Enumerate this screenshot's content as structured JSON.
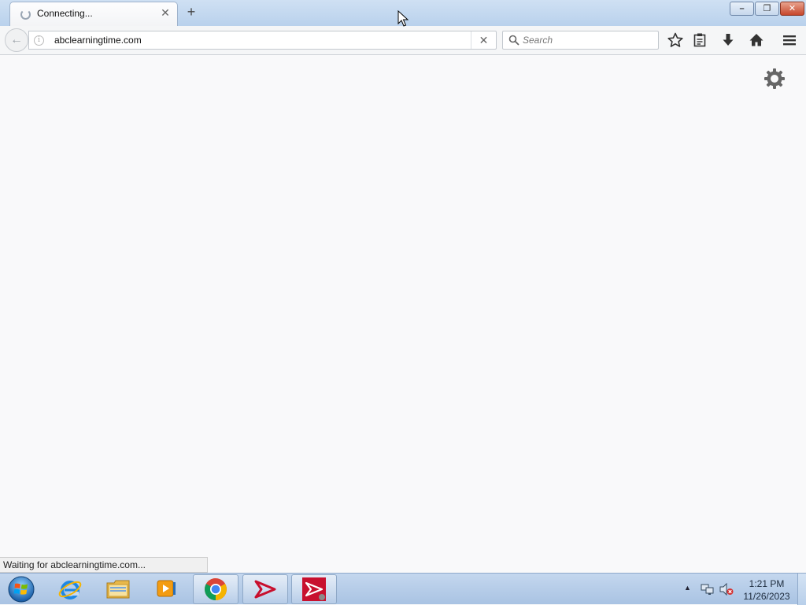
{
  "window": {
    "tab": {
      "title": "Connecting...",
      "close_glyph": "✕"
    },
    "new_tab_glyph": "+",
    "buttons": {
      "minimize_glyph": "–",
      "maximize_glyph": "❐",
      "close_glyph": "✕"
    }
  },
  "navbar": {
    "back_glyph": "←",
    "info_glyph": "i",
    "url": "abclearningtime.com",
    "stop_glyph": "✕",
    "search": {
      "placeholder": "Search"
    }
  },
  "icons": {
    "bookmark_star": "star-icon",
    "reading_list": "clipboard-icon",
    "downloads": "download-icon",
    "home": "home-icon",
    "menu": "hamburger-menu-icon",
    "page_settings": "gear-icon"
  },
  "status": {
    "text": "Waiting for abclearningtime.com..."
  },
  "taskbar": {
    "apps": [
      "Internet Explorer",
      "Windows Explorer",
      "Windows Media Player",
      "Google Chrome",
      "Adobe Acrobat",
      "Adobe Acrobat Pro"
    ],
    "clock": {
      "time": "1:21 PM",
      "date": "11/26/2023"
    },
    "tray_arrow_glyph": "▲"
  },
  "colors": {
    "accent_red": "#c8102e",
    "taskbar": "#b6cde9",
    "page_bg": "#f9f9fa"
  }
}
